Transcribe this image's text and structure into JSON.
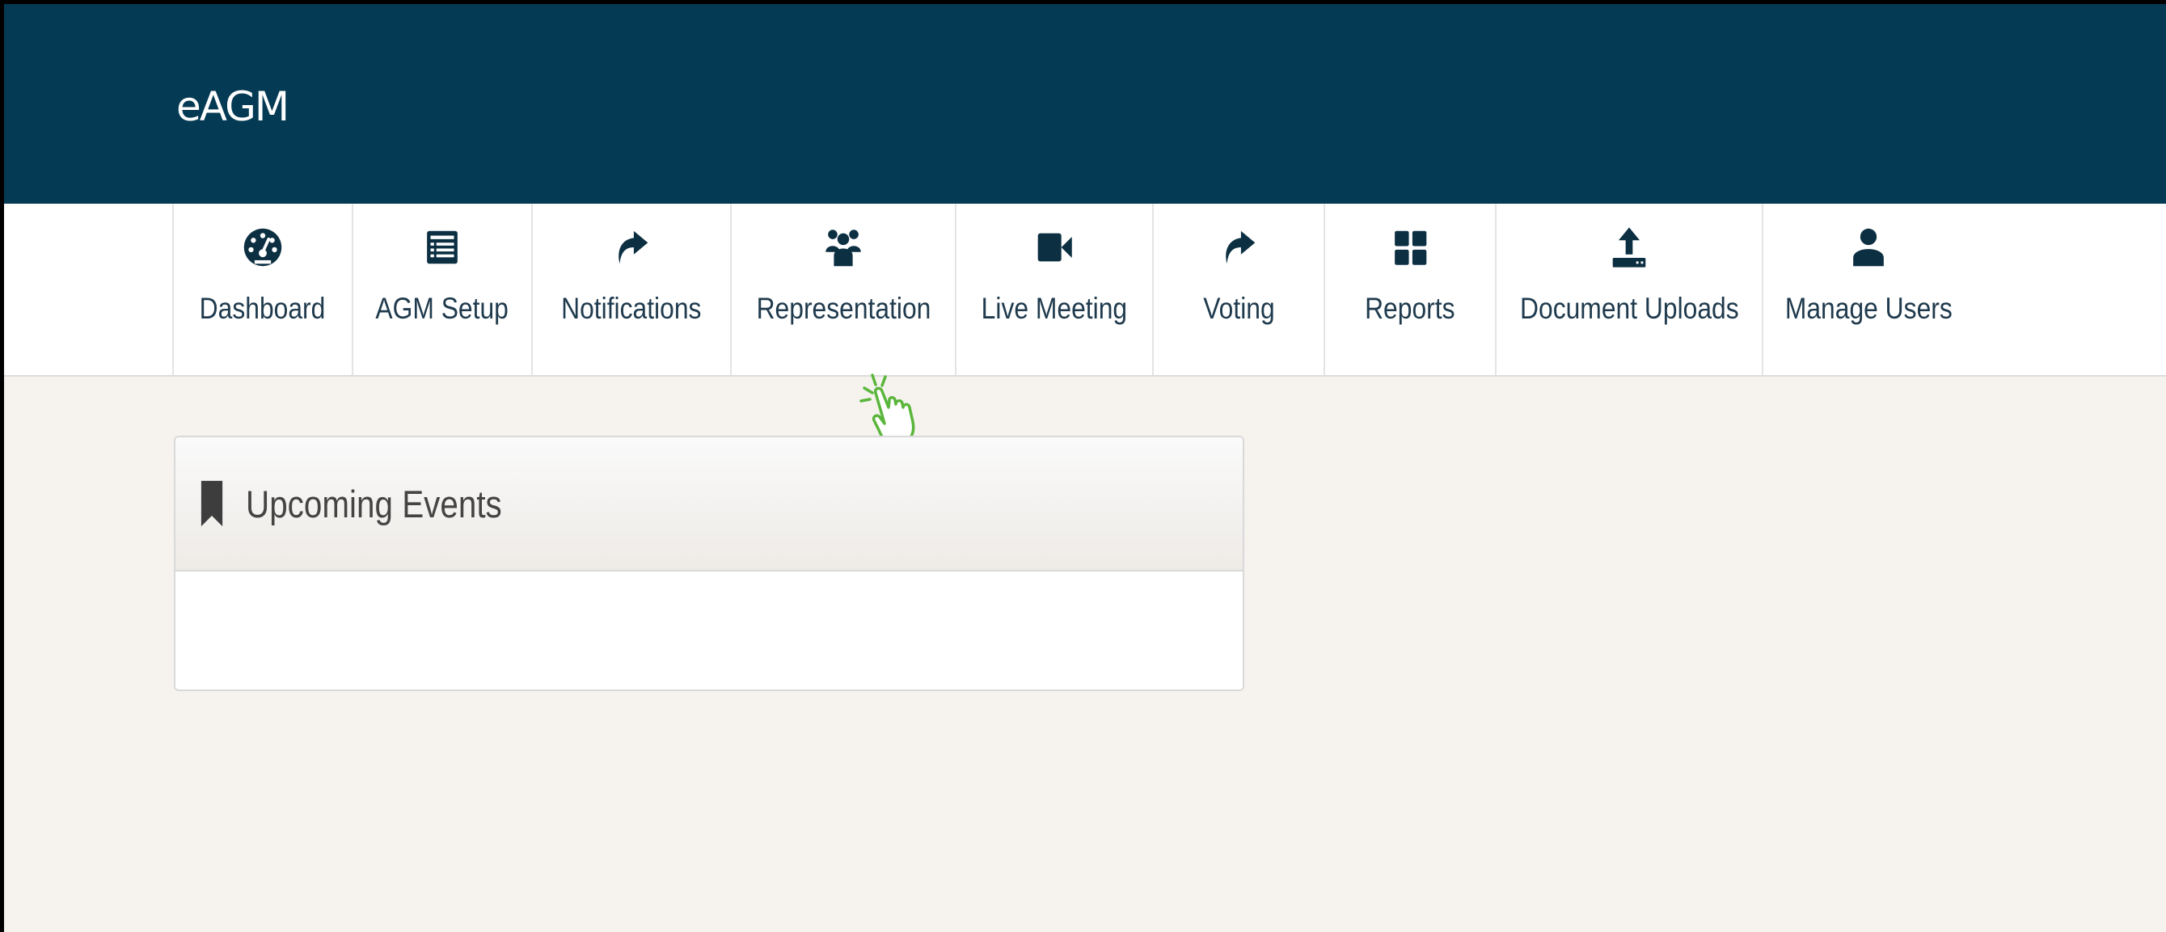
{
  "app": {
    "brand": "eAGM"
  },
  "nav": {
    "items": [
      {
        "label": "Dashboard",
        "icon": "dashboard-gauge-icon"
      },
      {
        "label": "AGM Setup",
        "icon": "list-document-icon"
      },
      {
        "label": "Notifications",
        "icon": "share-arrow-icon"
      },
      {
        "label": "Representation",
        "icon": "group-users-icon"
      },
      {
        "label": "Live Meeting",
        "icon": "video-camera-icon"
      },
      {
        "label": "Voting",
        "icon": "share-arrow-icon"
      },
      {
        "label": "Reports",
        "icon": "grid-tiles-icon"
      },
      {
        "label": "Document Uploads",
        "icon": "upload-icon"
      },
      {
        "label": "Manage Users",
        "icon": "user-icon"
      }
    ]
  },
  "panel": {
    "title": "Upcoming Events",
    "icon": "bookmark-icon"
  },
  "colors": {
    "header_bg": "#043a53",
    "nav_icon": "#0c2f42",
    "cursor": "#5ab63b"
  }
}
